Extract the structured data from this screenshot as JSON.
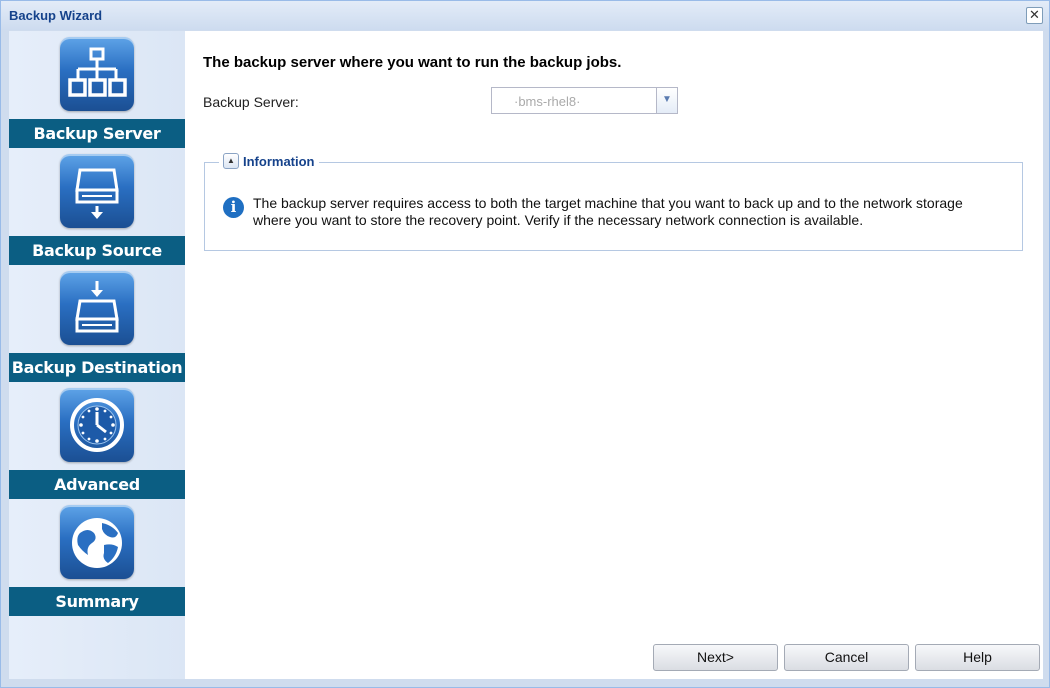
{
  "window": {
    "title": "Backup Wizard",
    "close_glyph": "✕"
  },
  "sidebar": {
    "steps": [
      {
        "label": "Backup Server",
        "icon": "network-tree-icon"
      },
      {
        "label": "Backup Source",
        "icon": "drive-download-icon"
      },
      {
        "label": "Backup Destination",
        "icon": "drive-upload-icon"
      },
      {
        "label": "Advanced",
        "icon": "clock-icon"
      },
      {
        "label": "Summary",
        "icon": "globe-icon"
      }
    ]
  },
  "main": {
    "heading": "The backup server where you want to run the backup jobs.",
    "server_label": "Backup Server:",
    "server_value": "·bms-rhel8·",
    "info": {
      "title": "Information",
      "text": "The backup server requires access to both the target machine that you want to back up and to the network storage where you want to store the recovery point. Verify if the necessary network connection is available."
    }
  },
  "buttons": {
    "next": "Next>",
    "cancel": "Cancel",
    "help": "Help"
  }
}
